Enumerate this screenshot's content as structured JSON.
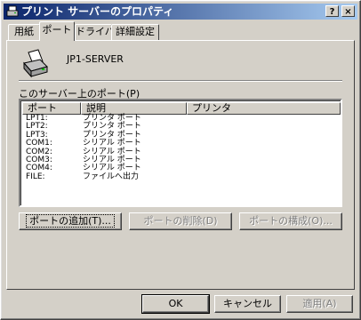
{
  "window": {
    "title": "プリント サーバーのプロパティ",
    "help_label": "?",
    "close_label": "×"
  },
  "tabs": [
    {
      "label": "用紙",
      "active": false
    },
    {
      "label": "ポート",
      "active": true
    },
    {
      "label": "ドライバ",
      "active": false
    },
    {
      "label": "詳細設定",
      "active": false
    }
  ],
  "server": {
    "name": "JP1-SERVER",
    "icon": "printer-server-icon"
  },
  "ports": {
    "label": "このサーバー上のポート(P)",
    "columns": [
      "ポート",
      "説明",
      "プリンタ"
    ],
    "rows": [
      {
        "port": "LPT1:",
        "description": "プリンタ ポート",
        "printer": ""
      },
      {
        "port": "LPT2:",
        "description": "プリンタ ポート",
        "printer": ""
      },
      {
        "port": "LPT3:",
        "description": "プリンタ ポート",
        "printer": ""
      },
      {
        "port": "COM1:",
        "description": "シリアル ポート",
        "printer": ""
      },
      {
        "port": "COM2:",
        "description": "シリアル ポート",
        "printer": ""
      },
      {
        "port": "COM3:",
        "description": "シリアル ポート",
        "printer": ""
      },
      {
        "port": "COM4:",
        "description": "シリアル ポート",
        "printer": ""
      },
      {
        "port": "FILE:",
        "description": "ファイルへ出力",
        "printer": ""
      }
    ]
  },
  "actions": {
    "add": "ポートの追加(T)...",
    "delete": "ポートの削除(D)",
    "configure": "ポートの構成(O)..."
  },
  "footer": {
    "ok": "OK",
    "cancel": "キャンセル",
    "apply": "適用(A)"
  }
}
